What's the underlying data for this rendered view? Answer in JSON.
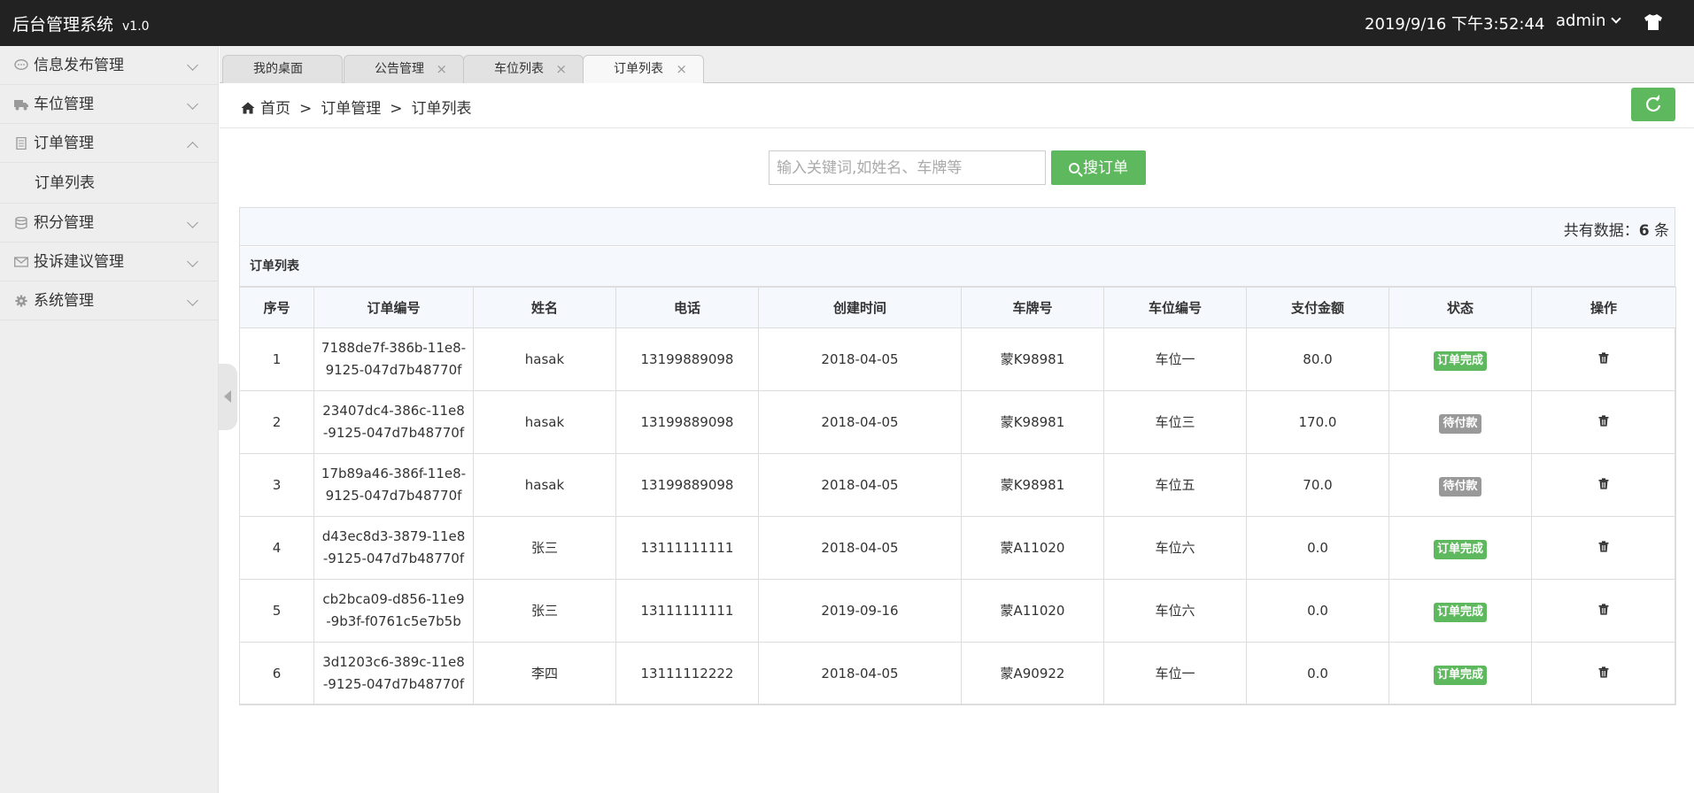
{
  "header": {
    "app_title": "后台管理系统",
    "version": "v1.0",
    "datetime": "2019/9/16 下午3:52:44",
    "user": "admin"
  },
  "sidebar": {
    "items": [
      {
        "label": "信息发布管理",
        "icon": "comment-icon",
        "expanded": false
      },
      {
        "label": "车位管理",
        "icon": "truck-icon",
        "expanded": false
      },
      {
        "label": "订单管理",
        "icon": "document-icon",
        "expanded": true,
        "children": [
          {
            "label": "订单列表"
          }
        ]
      },
      {
        "label": "积分管理",
        "icon": "database-icon",
        "expanded": false
      },
      {
        "label": "投诉建议管理",
        "icon": "envelope-icon",
        "expanded": false
      },
      {
        "label": "系统管理",
        "icon": "gear-icon",
        "expanded": false
      }
    ]
  },
  "tabs": [
    {
      "label": "我的桌面",
      "closable": false
    },
    {
      "label": "公告管理",
      "closable": true
    },
    {
      "label": "车位列表",
      "closable": true
    },
    {
      "label": "订单列表",
      "closable": true,
      "active": true
    }
  ],
  "breadcrumb": {
    "home": "首页",
    "sep": ">",
    "level1": "订单管理",
    "level2": "订单列表"
  },
  "search": {
    "placeholder": "输入关键词,如姓名、车牌等",
    "value": "",
    "button_label": "搜订单"
  },
  "panel": {
    "total_prefix": "共有数据：",
    "total_count": "6",
    "total_suffix": " 条",
    "title": "订单列表"
  },
  "table": {
    "columns": [
      "序号",
      "订单编号",
      "姓名",
      "电话",
      "创建时间",
      "车牌号",
      "车位编号",
      "支付金额",
      "状态",
      "操作"
    ],
    "rows": [
      {
        "idx": "1",
        "order_no_1": "7188de7f-386b-11e8-",
        "order_no_2": "9125-047d7b48770f",
        "name": "hasak",
        "phone": "13199889098",
        "created": "2018-04-05",
        "plate": "蒙K98981",
        "space": "车位一",
        "amount": "80.0",
        "status": "订单完成",
        "status_type": "done"
      },
      {
        "idx": "2",
        "order_no_1": "23407dc4-386c-11e8",
        "order_no_2": "-9125-047d7b48770f",
        "name": "hasak",
        "phone": "13199889098",
        "created": "2018-04-05",
        "plate": "蒙K98981",
        "space": "车位三",
        "amount": "170.0",
        "status": "待付款",
        "status_type": "wait"
      },
      {
        "idx": "3",
        "order_no_1": "17b89a46-386f-11e8-",
        "order_no_2": "9125-047d7b48770f",
        "name": "hasak",
        "phone": "13199889098",
        "created": "2018-04-05",
        "plate": "蒙K98981",
        "space": "车位五",
        "amount": "70.0",
        "status": "待付款",
        "status_type": "wait"
      },
      {
        "idx": "4",
        "order_no_1": "d43ec8d3-3879-11e8",
        "order_no_2": "-9125-047d7b48770f",
        "name": "张三",
        "phone": "13111111111",
        "created": "2018-04-05",
        "plate": "蒙A11020",
        "space": "车位六",
        "amount": "0.0",
        "status": "订单完成",
        "status_type": "done"
      },
      {
        "idx": "5",
        "order_no_1": "cb2bca09-d856-11e9",
        "order_no_2": "-9b3f-f0761c5e7b5b",
        "name": "张三",
        "phone": "13111111111",
        "created": "2019-09-16",
        "plate": "蒙A11020",
        "space": "车位六",
        "amount": "0.0",
        "status": "订单完成",
        "status_type": "done"
      },
      {
        "idx": "6",
        "order_no_1": "3d1203c6-389c-11e8",
        "order_no_2": "-9125-047d7b48770f",
        "name": "李四",
        "phone": "13111112222",
        "created": "2018-04-05",
        "plate": "蒙A90922",
        "space": "车位一",
        "amount": "0.0",
        "status": "订单完成",
        "status_type": "done"
      }
    ]
  },
  "colors": {
    "header_bg": "#222222",
    "accent_green": "#5eb95e",
    "badge_gray": "#999999",
    "sidebar_bg": "#eeeeee"
  }
}
